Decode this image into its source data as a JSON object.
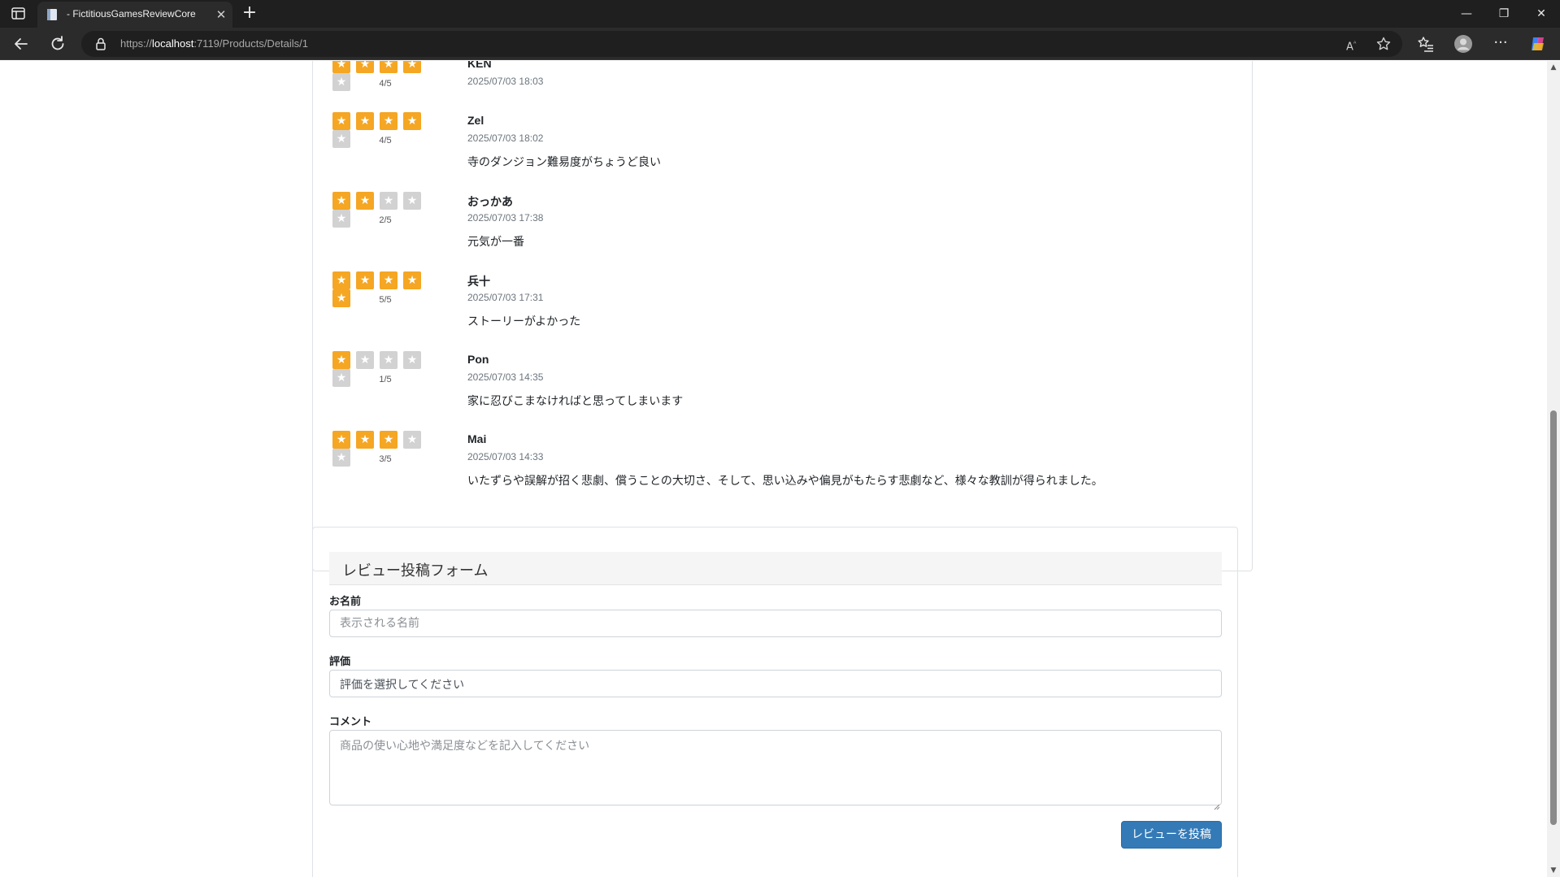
{
  "browser": {
    "tab_title": "- FictitiousGamesReviewCore",
    "url_scheme": "https://",
    "url_host": "localhost",
    "url_rest": ":7119/Products/Details/1"
  },
  "reviews": [
    {
      "name": "KEN",
      "rating": 4,
      "score_text": "4/5",
      "date": "2025/07/03 18:03",
      "comment": ""
    },
    {
      "name": "Zel",
      "rating": 4,
      "score_text": "4/5",
      "date": "2025/07/03 18:02",
      "comment": "寺のダンジョン難易度がちょうど良い"
    },
    {
      "name": "おっかあ",
      "rating": 2,
      "score_text": "2/5",
      "date": "2025/07/03 17:38",
      "comment": "元気が一番"
    },
    {
      "name": "兵十",
      "rating": 5,
      "score_text": "5/5",
      "date": "2025/07/03 17:31",
      "comment": "ストーリーがよかった"
    },
    {
      "name": "Pon",
      "rating": 1,
      "score_text": "1/5",
      "date": "2025/07/03 14:35",
      "comment": "家に忍びこまなければと思ってしまいます"
    },
    {
      "name": "Mai",
      "rating": 3,
      "score_text": "3/5",
      "date": "2025/07/03 14:33",
      "comment": "いたずらや誤解が招く悲劇、償うことの大切さ、そして、思い込みや偏見がもたらす悲劇など、様々な教訓が得られました。"
    }
  ],
  "form": {
    "title": "レビュー投稿フォーム",
    "name_label": "お名前",
    "name_placeholder": "表示される名前",
    "rating_label": "評価",
    "rating_selected": "評価を選択してください",
    "comment_label": "コメント",
    "comment_placeholder": "商品の使い心地や満足度などを記入してください",
    "submit_label": "レビューを投稿"
  },
  "colors": {
    "star_on": "#f5a623",
    "star_off": "#d2d2d2",
    "primary_button": "#337ab7"
  },
  "icons": [
    "tab-sidebar-icon",
    "page-favicon-icon",
    "close-icon",
    "plus-icon",
    "back-icon",
    "refresh-icon",
    "lock-icon",
    "read-aloud-icon",
    "star-outline-icon",
    "favorites-icon",
    "profile-icon",
    "more-icon",
    "copilot-icon",
    "minimize-icon",
    "restore-icon",
    "window-close-icon"
  ]
}
